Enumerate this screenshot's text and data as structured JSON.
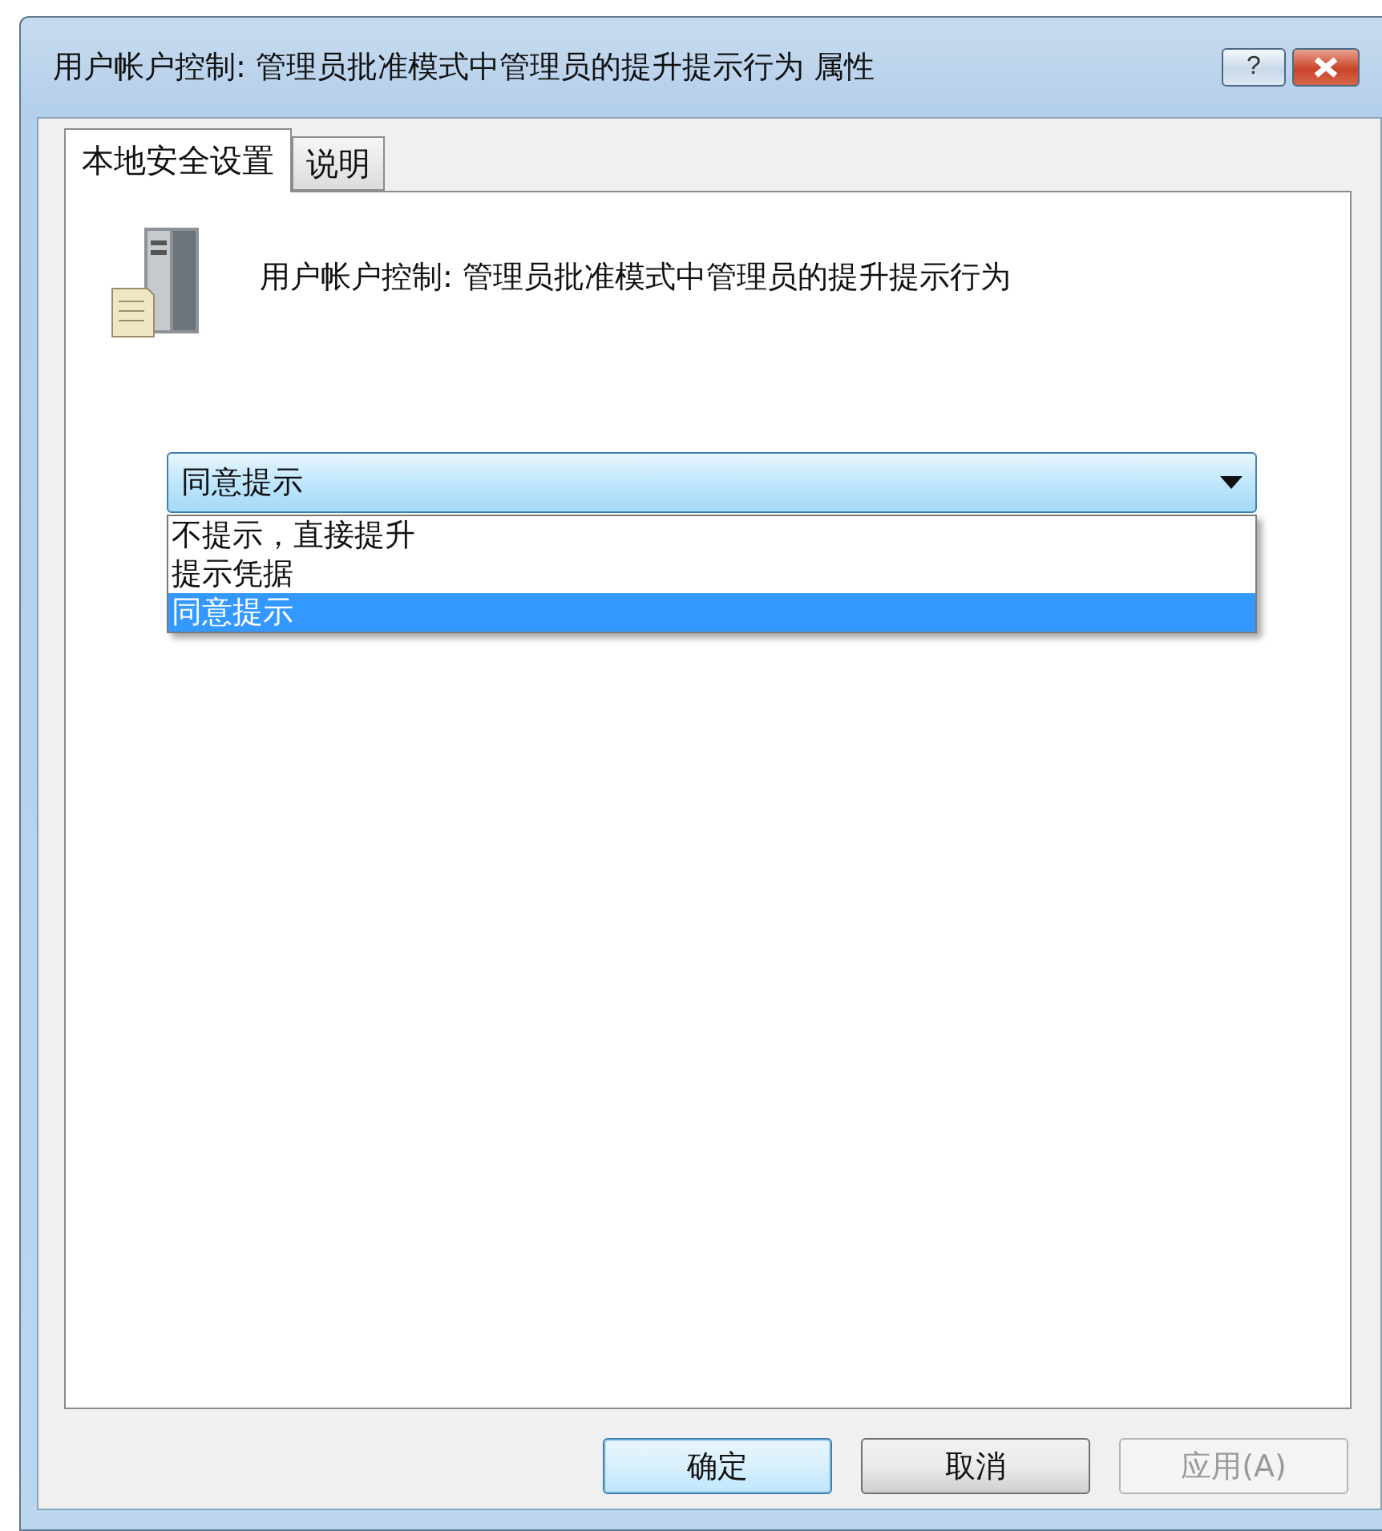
{
  "window": {
    "title": "用户帐户控制: 管理员批准模式中管理员的提升提示行为 属性",
    "help_button": "?"
  },
  "tabs": [
    {
      "label": "本地安全设置",
      "selected": true
    },
    {
      "label": "说明",
      "selected": false
    }
  ],
  "policy": {
    "name": "用户帐户控制: 管理员批准模式中管理员的提升提示行为"
  },
  "combo": {
    "value": "同意提示",
    "expanded": true,
    "options": [
      {
        "label": "不提示，直接提升",
        "selected": false
      },
      {
        "label": "提示凭据",
        "selected": false
      },
      {
        "label": "同意提示",
        "selected": true
      }
    ]
  },
  "buttons": [
    {
      "label": "确定",
      "default": true,
      "disabled": false
    },
    {
      "label": "取消",
      "default": false,
      "disabled": false
    },
    {
      "label": "应用(A)",
      "default": false,
      "disabled": true
    }
  ]
}
